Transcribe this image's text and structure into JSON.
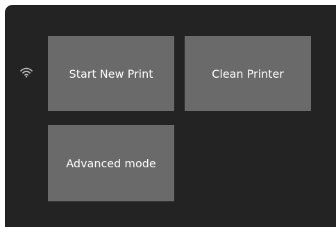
{
  "status": {
    "wifi_icon": "wifi-icon",
    "wifi_color": "#bdbdbd"
  },
  "menu": {
    "tiles": [
      {
        "label": "Start New Print"
      },
      {
        "label": "Clean Printer"
      },
      {
        "label": "Advanced mode"
      }
    ]
  },
  "colors": {
    "screen_bg": "#232323",
    "tile_bg": "#6a6a6a",
    "tile_text": "#ffffff"
  }
}
